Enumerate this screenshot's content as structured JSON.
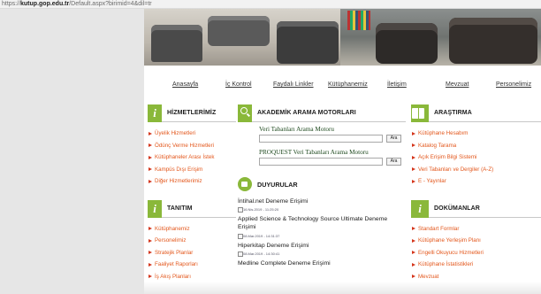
{
  "browser": {
    "url_prefix": "https://",
    "url_host": "kutup.gop.edu.tr",
    "url_path": "/Default.aspx?birimid=4&dil=tr"
  },
  "nav": {
    "items": [
      "Anasayfa",
      "İç Kontrol",
      "Faydalı Linkler",
      "Kütüphanemiz",
      "İletişim",
      "Mevzuat",
      "Personelimiz"
    ]
  },
  "left": {
    "services_title": "HİZMETLERİMİZ",
    "services": [
      "Üyelik Hizmetleri",
      "Ödünç Verme Hizmetleri",
      "Kütüphaneler Arası İstek",
      "Kampüs Dışı Erişim",
      "Diğer Hizmetlerimiz"
    ],
    "intro_title": "TANITIM",
    "intro": [
      "Kütüphanemiz",
      "Personelimiz",
      "Stratejik Planlar",
      "Faaliyet Raporları",
      "İş Akış Planları"
    ],
    "badge_letter": "i"
  },
  "middle": {
    "search_title": "AKADEMİK ARAMA MOTORLARI",
    "search1_label": "Veri Tabanları Arama Motoru",
    "search1_button": "Ara",
    "search2_label": "PROQUEST Veri Tabanları Arama Motoru",
    "search2_button": "Ara",
    "announcements_title": "DUYURULAR",
    "news": [
      {
        "title": "İntihal.net Deneme Erişimi",
        "date": "16.Nis.2019 - 11:25:20"
      },
      {
        "title": "Applied Science & Technology Source Ultimate Deneme Erişimi",
        "date": "08.Mar.2019 - 14:31:37"
      },
      {
        "title": "Hiperkitap Deneme Erişimi",
        "date": "08.Mar.2019 - 14:30:41"
      },
      {
        "title": "Medline Complete Deneme Erişimi",
        "date": ""
      }
    ]
  },
  "right": {
    "research_title": "ARAŞTIRMA",
    "research": [
      "Kütüphane Hesabım",
      "Katalog Tarama",
      "Açık Erişim Bilgi Sistemi",
      "Veri Tabanları ve Dergiler (A-Z)",
      "E - Yayınlar"
    ],
    "docs_title": "DOKÜMANLAR",
    "docs": [
      "Standart Formlar",
      "Kütüphane Yerleşim Planı",
      "Engelli Okuyucu Hizmetleri",
      "Kütüphane İstatistikleri",
      "Mevzuat"
    ],
    "badge_letter": "i"
  },
  "colors": {
    "accent_green": "#8ab83a",
    "link_orange": "#e3571c",
    "bullet_red": "#d4361c"
  },
  "icons": {
    "services": "info-icon",
    "search": "search-icon",
    "research": "book-icon",
    "announcements": "speaker-icon",
    "intro": "info-icon",
    "docs": "info-icon"
  }
}
